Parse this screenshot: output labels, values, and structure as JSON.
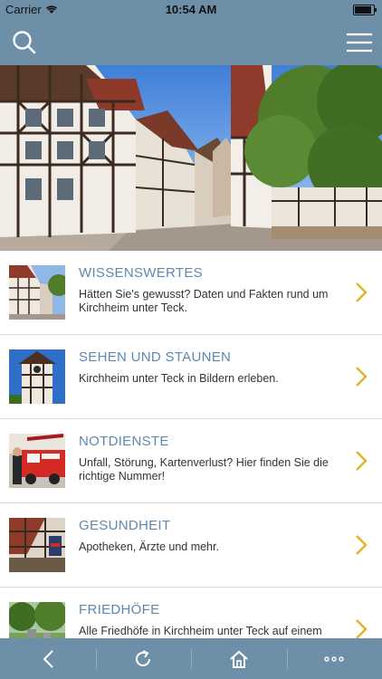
{
  "status_bar": {
    "carrier": "Carrier",
    "time": "10:54 AM",
    "battery_level": 1.0
  },
  "navbar": {
    "search_icon": "search-icon",
    "menu_icon": "hamburger-menu-icon"
  },
  "colors": {
    "bar": "#6e8fa8",
    "title": "#5f88ad",
    "chevron": "#e2b323"
  },
  "hero": {
    "description": "half-timbered houses street photo"
  },
  "items": [
    {
      "title": "WISSENSWERTES",
      "description": "Hätten Sie's gewusst? Daten und Fakten rund um Kirchheim unter Teck."
    },
    {
      "title": "SEHEN UND STAUNEN",
      "description": "Kirchheim unter Teck in Bildern erleben."
    },
    {
      "title": "NOTDIENSTE",
      "description": "Unfall, Störung, Kartenverlust? Hier finden Sie die richtige Nummer!"
    },
    {
      "title": "GESUNDHEIT",
      "description": "Apotheken, Ärzte und mehr."
    },
    {
      "title": "FRIEDHÖFE",
      "description": "Alle Friedhöfe in Kirchheim unter Teck auf einem Blick."
    }
  ],
  "toolbar": {
    "icons": [
      "back-icon",
      "reload-icon",
      "home-icon",
      "more-icon"
    ]
  }
}
